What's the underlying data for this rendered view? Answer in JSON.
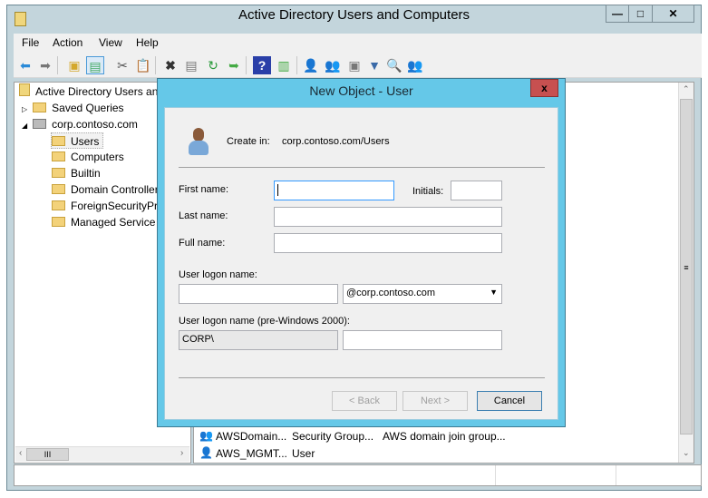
{
  "window": {
    "title": "Active Directory Users and Computers",
    "minimize": "—",
    "maximize": "□",
    "close": "✕"
  },
  "menu": [
    "File",
    "Action",
    "View",
    "Help"
  ],
  "toolbar": [
    "back-icon",
    "forward-icon",
    "up-folder-icon",
    "show-console-tree-icon",
    "cut-icon",
    "paste-icon",
    "delete-icon",
    "properties-icon",
    "refresh-icon",
    "export-list-icon",
    "help-icon",
    "action-pane-icon",
    "new-user-icon",
    "new-group-icon",
    "new-ou-icon",
    "filter-icon",
    "find-icon",
    "add-to-group-icon"
  ],
  "tree": {
    "root": "Active Directory Users and Computers",
    "items": [
      "Saved Queries",
      "corp.contoso.com",
      "Users",
      "Computers",
      "Builtin",
      "Domain Controllers",
      "ForeignSecurityPrincipals",
      "Managed Service Accounts"
    ]
  },
  "list": [
    {
      "name": "AWSDomain...",
      "type": "Security Group...",
      "description": "AWS domain join group..."
    },
    {
      "name": "AWS_MGMT...",
      "type": "User",
      "description": ""
    }
  ],
  "dialog": {
    "title": "New Object - User",
    "close": "x",
    "create_in_label": "Create in:",
    "create_in_value": "corp.contoso.com/Users",
    "first_name_label": "First name:",
    "first_name": "",
    "initials_label": "Initials:",
    "initials": "",
    "last_name_label": "Last name:",
    "last_name": "",
    "full_name_label": "Full name:",
    "full_name": "",
    "logon_label": "User logon name:",
    "logon": "",
    "domain": "@corp.contoso.com",
    "pre2000_label": "User logon name (pre-Windows 2000):",
    "pre2000_prefix": "CORP\\",
    "pre2000": "",
    "back": "< Back",
    "next": "Next >",
    "cancel": "Cancel"
  }
}
